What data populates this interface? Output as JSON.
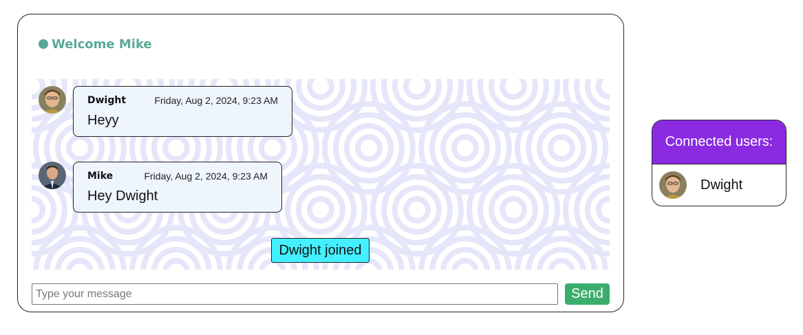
{
  "colors": {
    "accent": "#5aa896",
    "send": "#3cae6c",
    "users_header": "#8a2be2",
    "pattern": "#e6e6fa",
    "system_note": "#44f0ff",
    "bubble_bg": "#eef5fd"
  },
  "header": {
    "status_icon": "online-dot-icon",
    "welcome_text": "Welcome Mike"
  },
  "messages": [
    {
      "user": "Dwight",
      "timestamp": "Friday, Aug 2, 2024, 9:23 AM",
      "text": "Heyy",
      "avatar": "dwight-avatar"
    },
    {
      "user": "Mike",
      "timestamp": "Friday, Aug 2, 2024, 9:23 AM",
      "text": "Hey Dwight",
      "avatar": "mike-avatar"
    }
  ],
  "system_notice": "Dwight joined",
  "composer": {
    "placeholder": "Type your message",
    "value": "",
    "send_label": "Send"
  },
  "connected_users": {
    "title": "Connected users:",
    "users": [
      {
        "name": "Dwight",
        "avatar": "dwight-avatar"
      }
    ]
  }
}
